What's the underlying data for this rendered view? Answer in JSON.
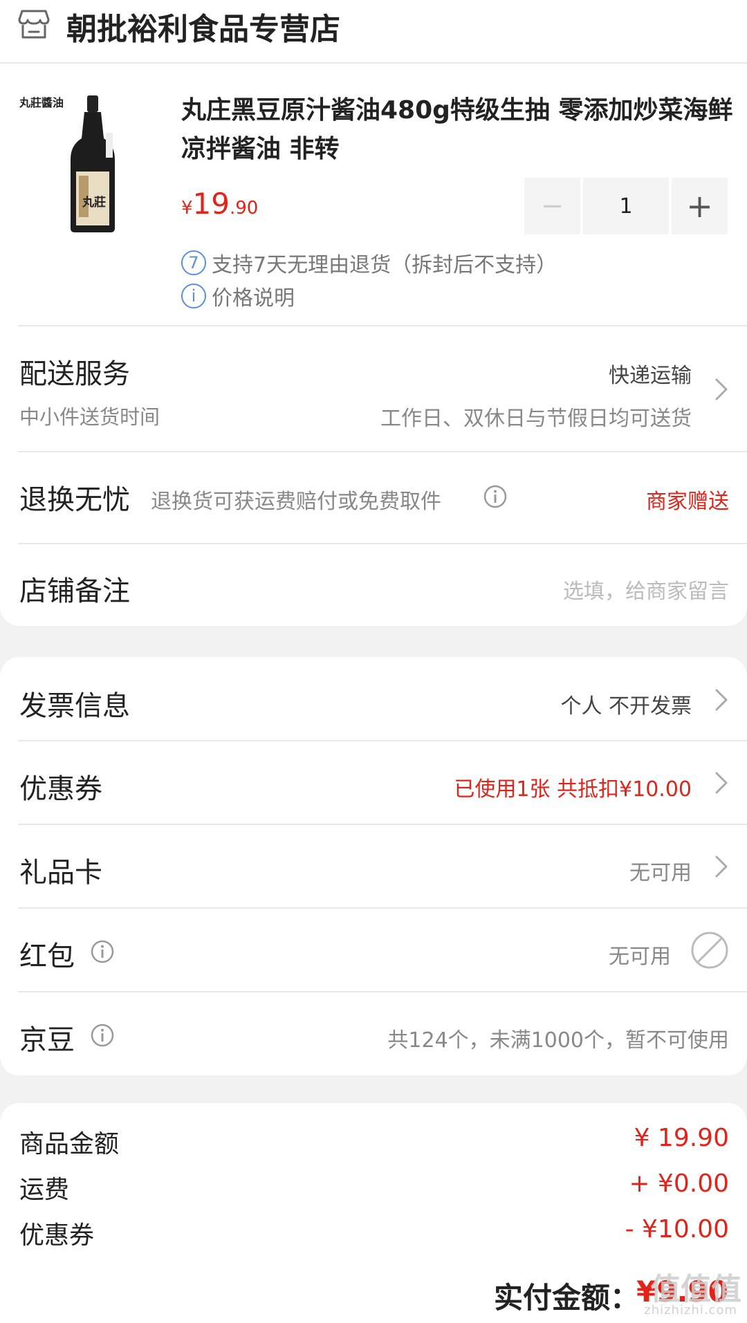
{
  "header": {
    "store_name": "朝批裕利食品专营店"
  },
  "product": {
    "image_label": "丸莊醬油",
    "bottle_label": "丸莊",
    "title": "丸庄黑豆原汁酱油480g特级生抽 零添加炒菜海鲜凉拌酱油 非转",
    "price_currency": "¥",
    "price_int": "19",
    "price_dec": ".90",
    "quantity": "1",
    "minus_glyph": "−",
    "plus_glyph": "+",
    "return_badge": "7",
    "return_policy": "支持7天无理由退货（拆封后不支持）",
    "info_glyph": "i",
    "price_note": "价格说明"
  },
  "delivery": {
    "label": "配送服务",
    "method": "快递运输",
    "sub_label": "中小件送货时间",
    "sub_value": "工作日、双休日与节假日均可送货"
  },
  "returns": {
    "label": "退换无忧",
    "desc": "退换货可获运费赔付或免费取件",
    "value": "商家赠送"
  },
  "note": {
    "label": "店铺备注",
    "placeholder": "选填，给商家留言"
  },
  "invoice": {
    "label": "发票信息",
    "value": "个人 不开发票"
  },
  "coupon": {
    "label": "优惠券",
    "value": "已使用1张 共抵扣¥10.00"
  },
  "gift_card": {
    "label": "礼品卡",
    "value": "无可用"
  },
  "red_packet": {
    "label": "红包",
    "value": "无可用"
  },
  "jingdou": {
    "label": "京豆",
    "value": "共124个，未满1000个，暂不可使用"
  },
  "summary": {
    "goods_label": "商品金额",
    "goods_value": "¥ 19.90",
    "shipping_label": "运费",
    "shipping_value": "+ ¥0.00",
    "coupon_label": "优惠券",
    "coupon_value": "- ¥10.00",
    "total_label": "实付金额：",
    "total_value": "¥9.90"
  },
  "watermark": {
    "text": "值值值",
    "domain": "zhizhizhi.com"
  },
  "colors": {
    "accent_red": "#e2231a",
    "info_blue": "#5b8fd8"
  }
}
